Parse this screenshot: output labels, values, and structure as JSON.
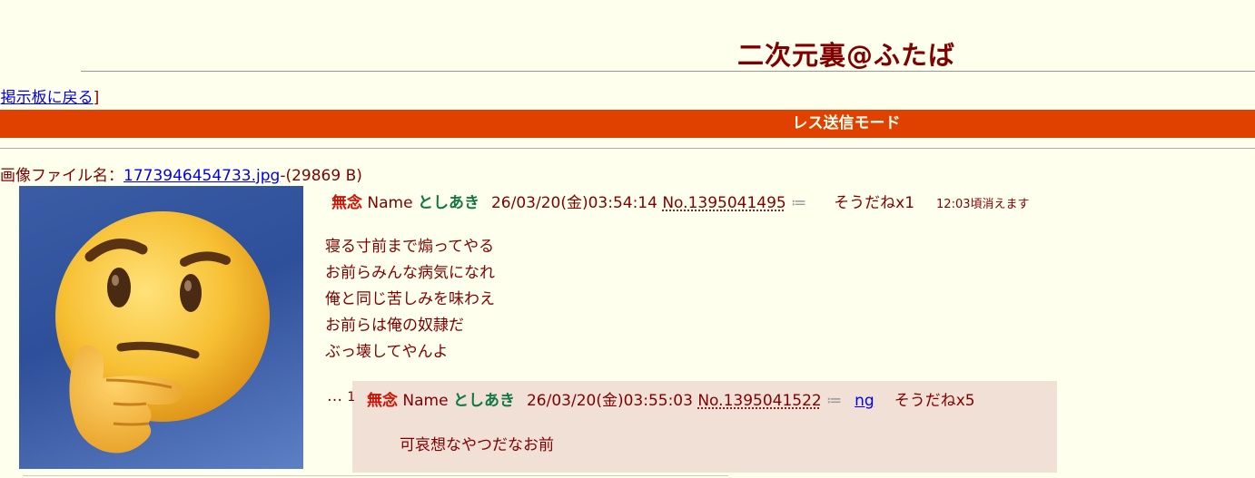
{
  "header": {
    "title": "二次元裏@ふたば"
  },
  "nav": {
    "open_bracket": "[",
    "back_link": "掲示板に戻る",
    "close_bracket": "]"
  },
  "mode_bar": {
    "label": "レス送信モード",
    "color": "#e04000"
  },
  "file": {
    "prefix": "画像ファイル名：",
    "filename": "1773946454733.jpg",
    "size": "-(29869 B)"
  },
  "thumbnail": {
    "subject": "thinking-face emoji"
  },
  "op": {
    "subject": "無念",
    "name_label": "Name",
    "name": "としあき",
    "datetime": "26/03/20(金)03:54:14",
    "number": "No.1395041495",
    "menu_icon": "list-menu-icon",
    "soudane": "そうだねx1",
    "expire": "12:03頃消えます",
    "lines": [
      "寝る寸前まで煽ってやる",
      "お前らみんな病気になれ",
      "俺と同じ苦しみを味わえ",
      "お前らは俺の奴隷だ",
      "ぶっ壊してやんよ"
    ]
  },
  "reply": {
    "dots": "…",
    "index": "1",
    "subject": "無念",
    "name_label": "Name",
    "name": "としあき",
    "datetime": "26/03/20(金)03:55:03",
    "number": "No.1395041522",
    "menu_icon": "list-menu-icon",
    "ng": "ng",
    "soudane": "そうだねx5",
    "body": "可哀想なやつだなお前"
  }
}
